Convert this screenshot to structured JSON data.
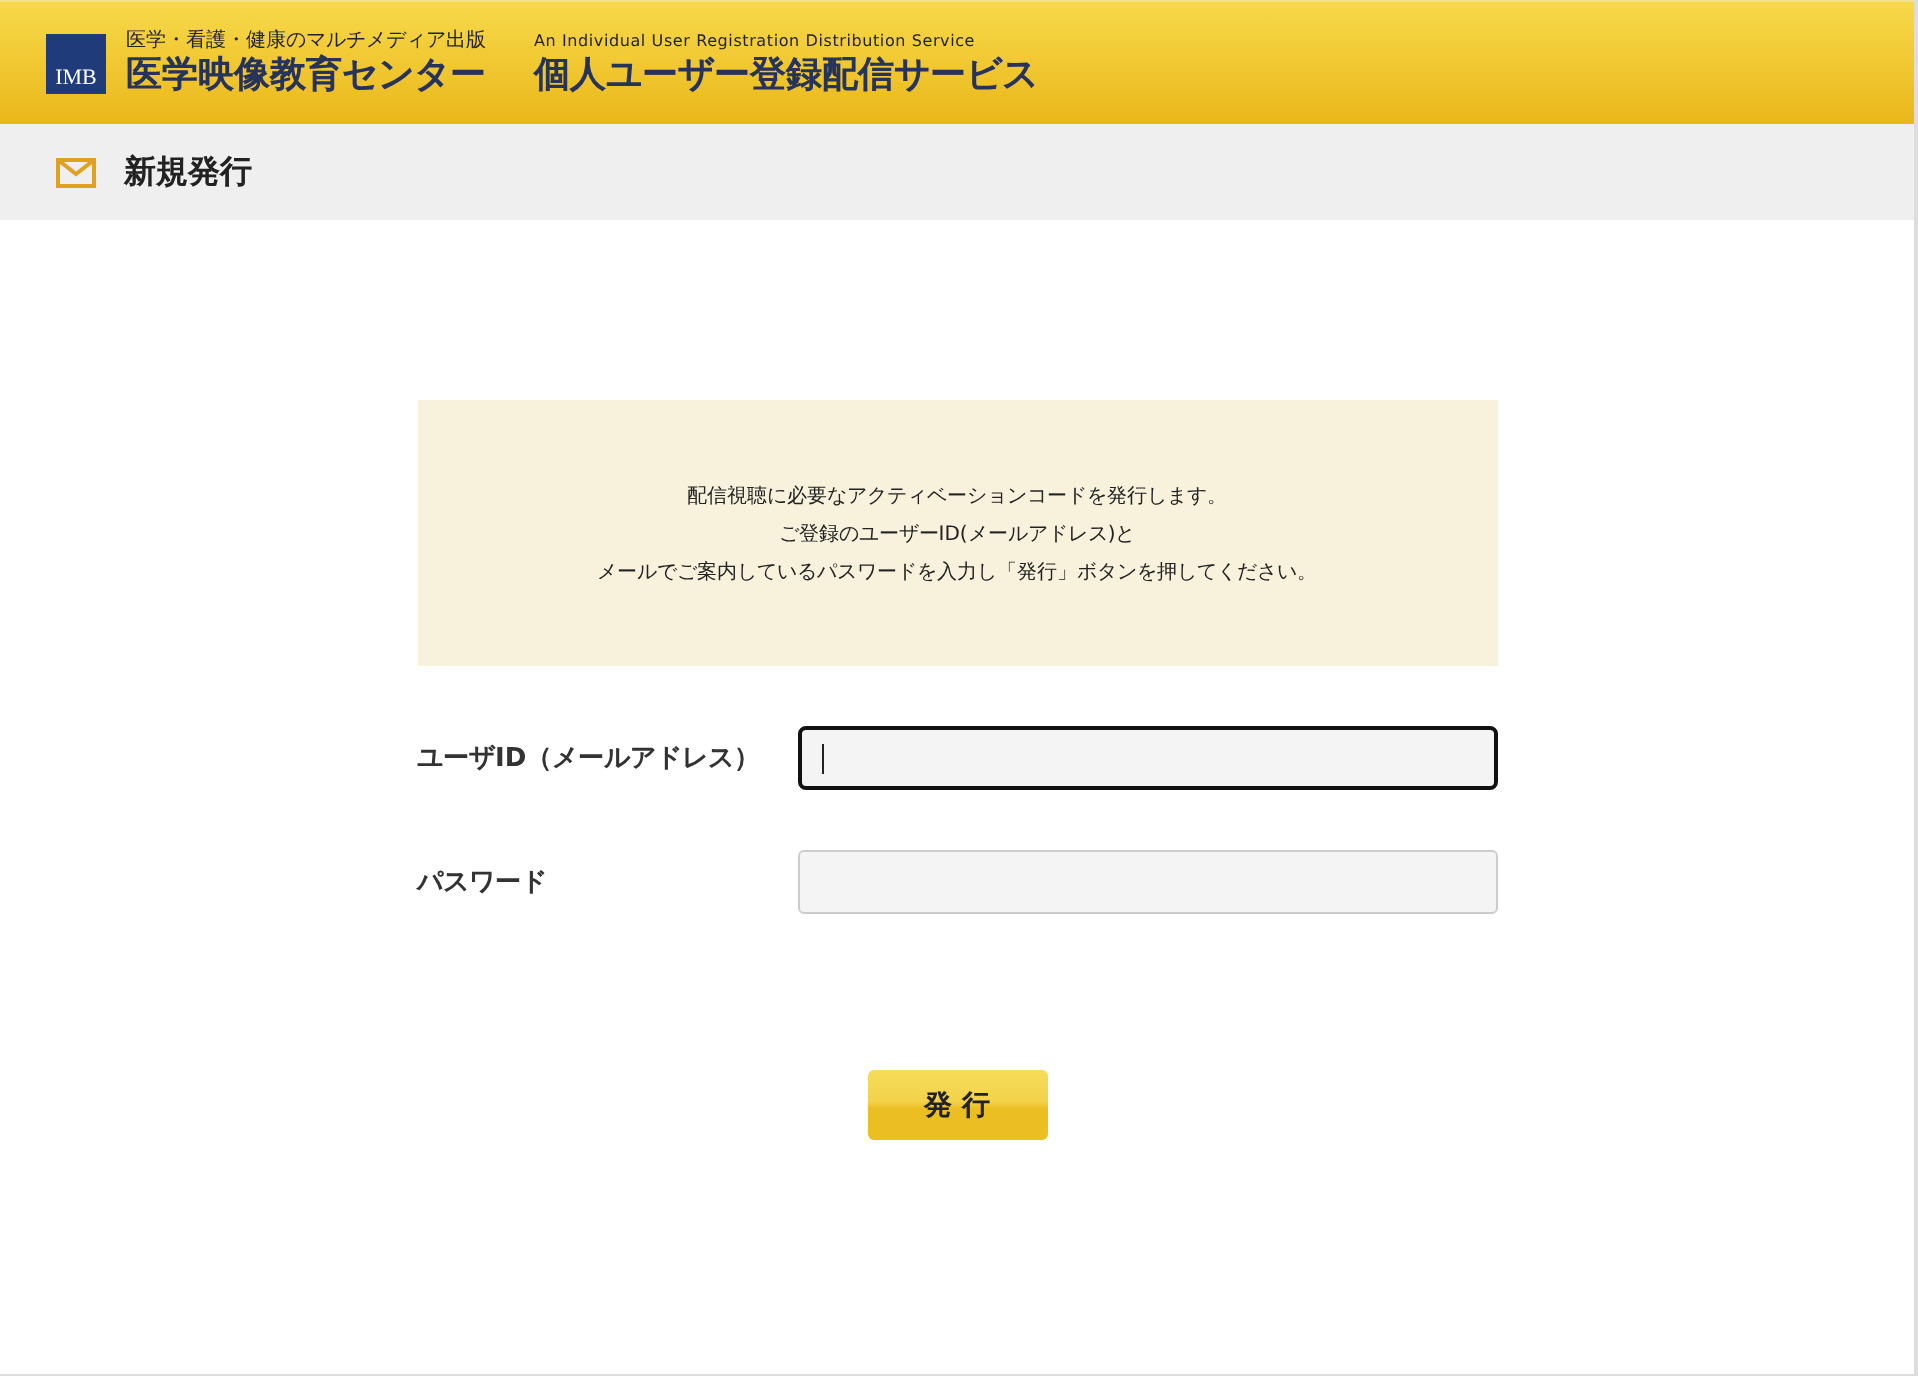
{
  "header": {
    "logo_text": "IMB",
    "tagline": "医学・看護・健康のマルチメディア出版",
    "brand": "医学映像教育センター",
    "service_en": "An Individual User Registration Distribution Service",
    "service_ja": "個人ユーザー登録配信サービス"
  },
  "page_title": "新規発行",
  "notice_lines": [
    "配信視聴に必要なアクティベーションコードを発行します。",
    "ご登録のユーザーID(メールアドレス)と",
    "メールでご案内しているパスワードを入力し「発行」ボタンを押してください。"
  ],
  "fields": [
    {
      "label": "ユーザID（メールアドレス）",
      "focused": true
    },
    {
      "label": "パスワード",
      "focused": false
    }
  ],
  "submit_button": "発 行"
}
